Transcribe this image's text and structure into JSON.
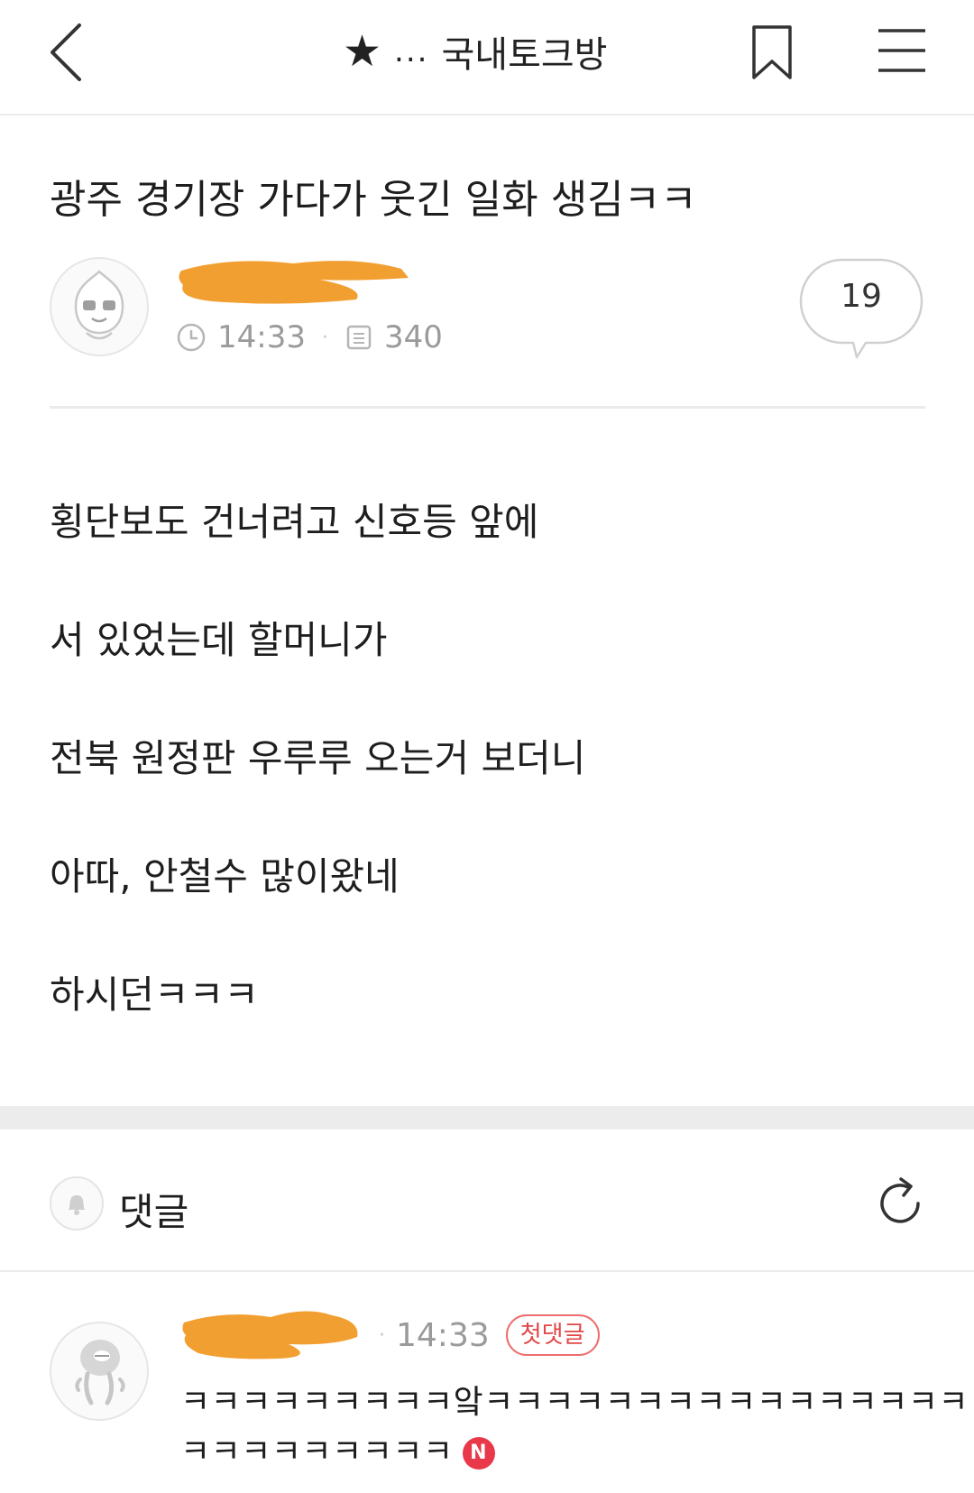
{
  "header": {
    "board_name": "국내토크방",
    "ellipsis": "...",
    "star_glyph": "★",
    "icons": [
      "chevron-left-icon",
      "star-icon",
      "bookmark-icon",
      "hamburger-menu-icon"
    ]
  },
  "post": {
    "title": "광주 경기장 가다가 웃긴 일화 생김ㅋㅋ",
    "time": "14:33",
    "views": "340",
    "comment_count": "19",
    "body_lines": [
      "횡단보도 건너려고 신호등 앞에",
      "서 있었는데 할머니가",
      "전북 원정판 우루루 오는거 보더니",
      "아따, 안철수 많이왔네",
      "하시던ㅋㅋㅋ"
    ]
  },
  "comments": {
    "label": "댓글",
    "items": [
      {
        "time": "14:33",
        "badge": "첫댓글",
        "text_line1": "ㅋㅋㅋㅋㅋㅋㅋㅋㅋ앜ㅋㅋㅋㅋㅋㅋㅋㅋㅋㅋㅋㅋㅋㅋㅋㅋㅋ",
        "text_line2": "ㅋㅋㅋㅋㅋㅋㅋㅋㅋ",
        "new_badge": "N"
      }
    ]
  },
  "colors": {
    "redaction": "#f19a26",
    "badge_red": "#e14848",
    "new_badge": "#e8384a",
    "muted_text": "#9a9a9a"
  }
}
